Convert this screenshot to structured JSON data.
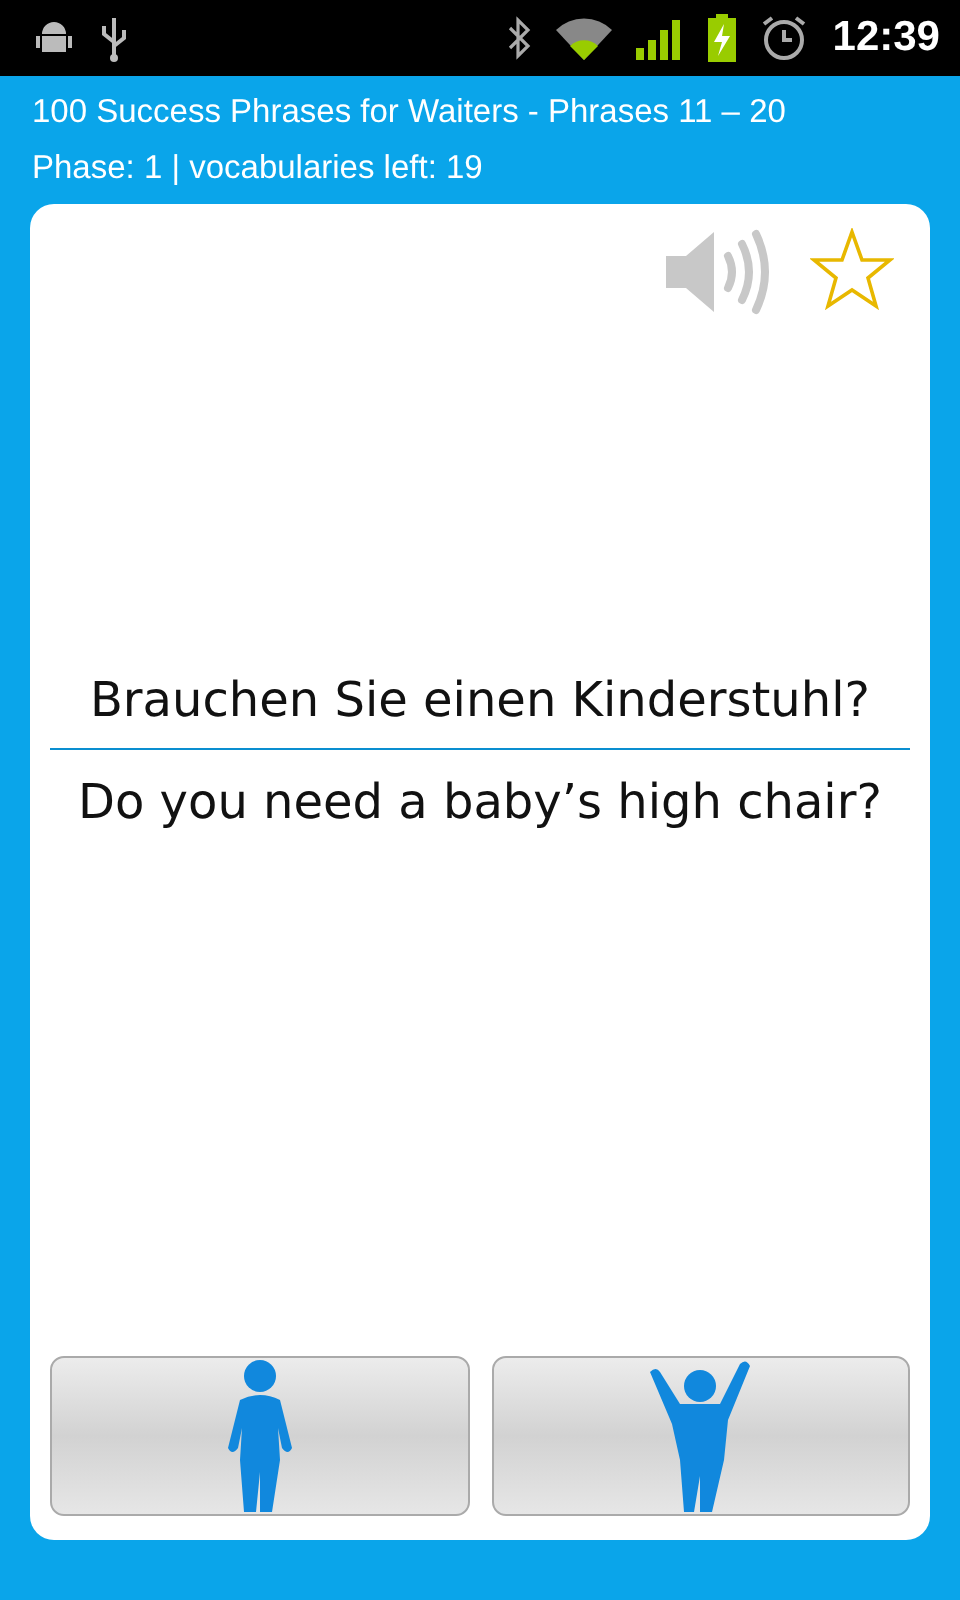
{
  "status_bar": {
    "time": "12:39"
  },
  "header": {
    "title": "100 Success Phrases for Waiters - Phrases 11 – 20",
    "subtitle": "Phase: 1 | vocabularies left: 19"
  },
  "card": {
    "starred": false,
    "phrase": "Brauchen Sie einen Kinderstuhl?",
    "translation": "Do you need a baby’s high chair?"
  },
  "answer_buttons": [
    {
      "kind": "unknown"
    },
    {
      "kind": "known"
    }
  ]
}
